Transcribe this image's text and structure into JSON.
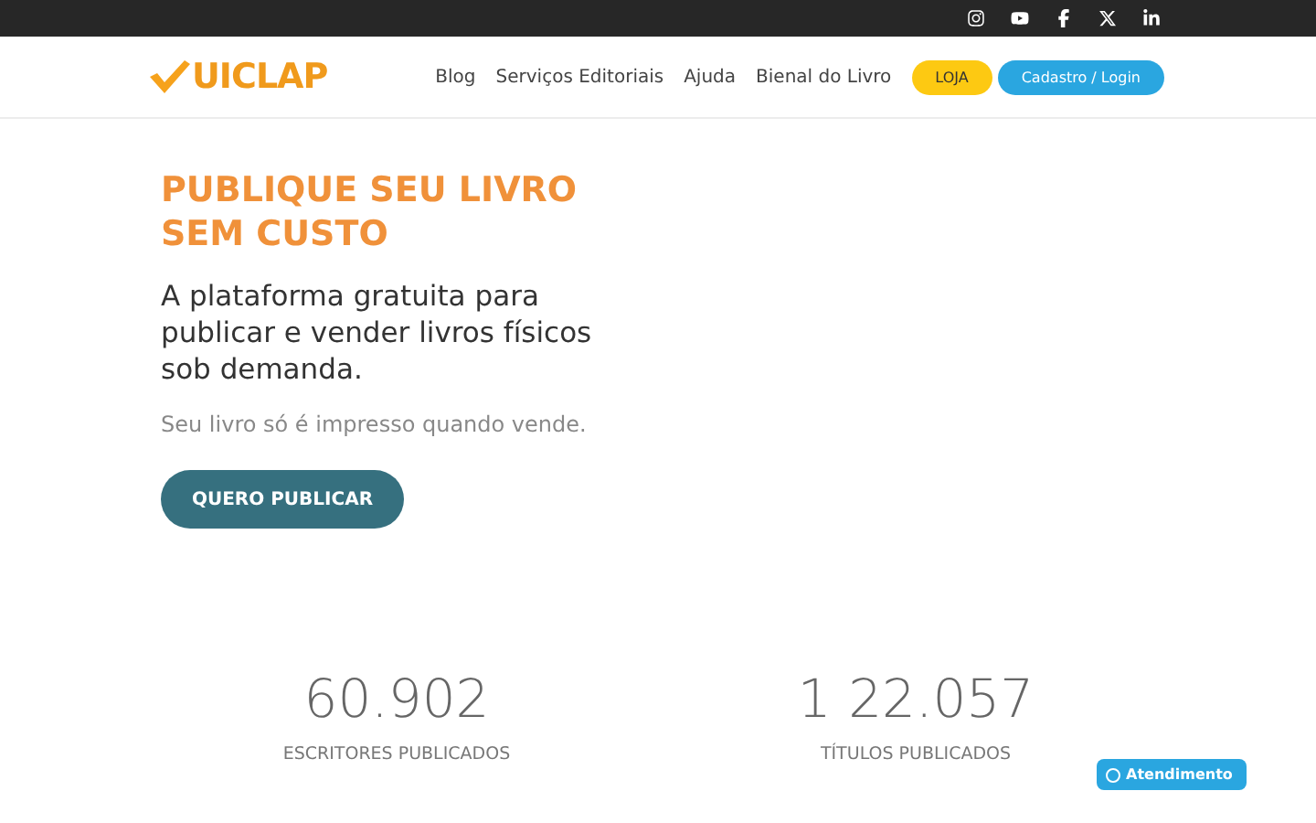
{
  "logo": {
    "text": "UICLAP"
  },
  "nav": {
    "links": [
      "Blog",
      "Serviços Editoriais",
      "Ajuda",
      "Bienal do Livro"
    ],
    "buttons": [
      {
        "label": "LOJA",
        "kind": "store"
      },
      {
        "label": "Cadastro / Login",
        "kind": "login"
      }
    ]
  },
  "hero": {
    "title_lines": [
      "PUBLIQUE SEU LIVRO",
      "SEM CUSTO"
    ],
    "subtitle": "A plataforma gratuita para publicar e vender livros físicos sob demanda.",
    "note": "Seu livro só é impresso quando vende.",
    "cta": "QUERO PUBLICAR"
  },
  "stats": [
    {
      "value": "60.902",
      "label": "ESCRITORES PUBLICADOS"
    },
    {
      "value": "1 22.057",
      "label": "TÍTULOS PUBLICADOS"
    }
  ],
  "support_button": {
    "label": "Atendimento"
  }
}
